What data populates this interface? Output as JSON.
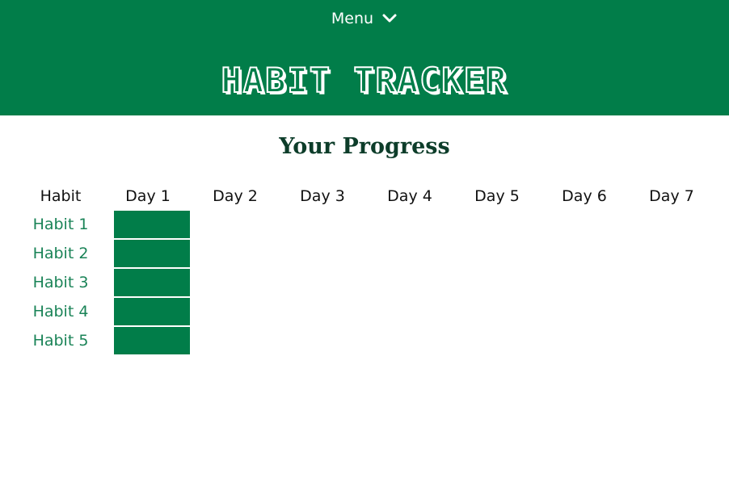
{
  "header": {
    "menu_label": "Menu",
    "menu_icon": "chevron-down-icon",
    "app_title": "HABIT TRACKER",
    "background_color": "#017d49"
  },
  "main": {
    "title": "Your Progress",
    "columns": [
      "Habit",
      "Day 1",
      "Day 2",
      "Day 3",
      "Day 4",
      "Day 5",
      "Day 6",
      "Day 7"
    ],
    "habits": [
      {
        "name": "Habit 1",
        "days": [
          true,
          false,
          false,
          false,
          false,
          false,
          false
        ]
      },
      {
        "name": "Habit 2",
        "days": [
          true,
          false,
          false,
          false,
          false,
          false,
          false
        ]
      },
      {
        "name": "Habit 3",
        "days": [
          true,
          false,
          false,
          false,
          false,
          false,
          false
        ]
      },
      {
        "name": "Habit 4",
        "days": [
          true,
          false,
          false,
          false,
          false,
          false,
          false
        ]
      },
      {
        "name": "Habit 5",
        "days": [
          true,
          false,
          false,
          false,
          false,
          false,
          false
        ]
      }
    ],
    "complete_color": "#017d49"
  }
}
